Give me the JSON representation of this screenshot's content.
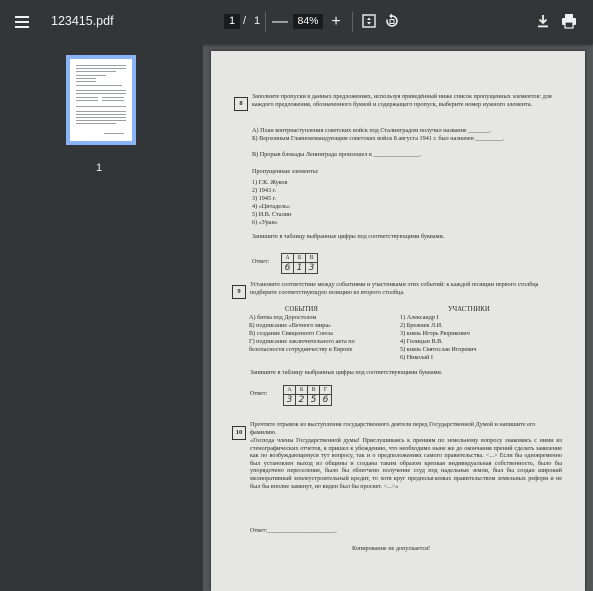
{
  "toolbar": {
    "file_name": "123415.pdf",
    "current_page": "1",
    "page_separator": "/",
    "total_pages": "1",
    "zoom_minus": "—",
    "zoom_value": "84%",
    "zoom_plus": "+",
    "icons": [
      "menu-icon",
      "fit-page-icon",
      "rotate-icon",
      "download-icon",
      "print-icon"
    ]
  },
  "sidebar": {
    "thumbnail_label": "1"
  },
  "document": {
    "q8": {
      "number": "8",
      "prompt": "Заполните пропуски в данных предложениях, используя приведённый ниже список пропущенных элементов: для каждого предложения, обозначенного буквой и содержащего пропуск, выберите номер нужного элемента.",
      "sentence_a": "А) План контрнаступления советских войск под Сталинградом получил название _______.",
      "sentence_b": "Б) Верховным Главнокомандующим советских войск 8 августа 1941 г. был назначен _________.",
      "sentence_v": "В) Прорыв блокады Ленинграда произошел в _______________.",
      "list_title": "Пропущенные элементы:",
      "items": [
        "1) Г.К. Жуков",
        "2) 1943 г.",
        "3) 1945 г.",
        "4) «Цитадель»",
        "5) И.В. Сталин",
        "6) «Уран»"
      ],
      "instruction": "Запишите в таблицу выбранные цифры под соответствующими буквами.",
      "answer_label": "Ответ:",
      "answer_headers": [
        "А",
        "Б",
        "В"
      ],
      "answer_values": [
        "6",
        "1",
        "3"
      ]
    },
    "q9": {
      "number": "9",
      "prompt": "Установите соответствие между событиями и участниками этих событий: к каждой позиции первого столбца подберите соответствующую позицию из второго столбца.",
      "events_title": "СОБЫТИЯ",
      "participants_title": "УЧАСТНИКИ",
      "events": [
        "А) битва под Доростолом",
        "Б) подписание «Вечного мира»",
        "В) создание Священного Союза",
        "Г) подписание заключительного акта по безопасности сотрудничеству в Европе"
      ],
      "participants": [
        "1) Александр I",
        "2) Брежнев Л.И.",
        "3) князь Игорь Рюрикович",
        "4) Голицын В.В.",
        "5) князь Святослав Игоревич",
        "6) Николай I"
      ],
      "instruction": "Запишите в таблицу выбранные цифры под соответствующими буквами.",
      "answer_label": "Ответ:",
      "answer_headers": [
        "А",
        "Б",
        "В",
        "Г"
      ],
      "answer_values": [
        "3",
        "2",
        "5",
        "6"
      ]
    },
    "q10": {
      "number": "10",
      "prompt": "Прочтите отрывок из выступления государственного деятеля перед Государственной Думой и напишите его фамилию.",
      "quote": "«Господа члены Государственной думы! Прислушиваясь к прениям по земельному вопросу знакомясь с ними из стенографических отчетов, я пришел к убеждению, что необходимо ныне же до окончания прений сделать заявление как по возбуждающемуся тут вопросу, так и о предположениях самого правительства. <...> Если бы одновременно был установлен выход из общины и создана таким образом крепкая индивидуальная собственность, было бы упорядочено переселение, было бы облегчено получение ссуд под надельные земли, был бы создан широкий мелиоративный землеустроительный кредит, то хотя круг предполагаемых правительством земельных реформ и не был бы вполне замкнут, но виден был бы просвет. <...>»",
      "answer_label": "Ответ:______________________.",
      "footer": "Копирование не допускается!"
    }
  }
}
